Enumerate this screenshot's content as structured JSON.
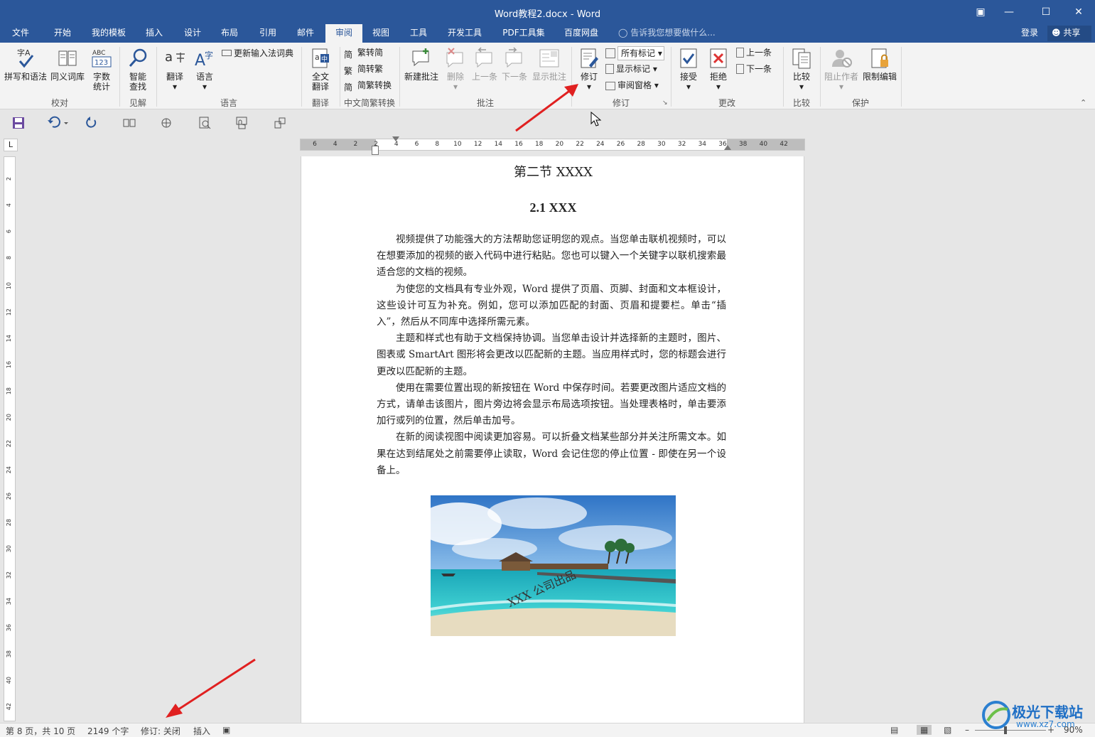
{
  "window": {
    "title": "Word教程2.docx - Word"
  },
  "menu": {
    "tabs": [
      "文件",
      "开始",
      "我的模板",
      "插入",
      "设计",
      "布局",
      "引用",
      "邮件",
      "审阅",
      "视图",
      "工具",
      "开发工具",
      "PDF工具集",
      "百度网盘"
    ],
    "active_tab": "审阅",
    "tell_me": "告诉我您想要做什么...",
    "login": "登录",
    "share": "共享"
  },
  "ribbon": {
    "groups": {
      "proofing": "校对",
      "insights": "见解",
      "language": "语言",
      "translate": "翻译",
      "chinese_conv": "中文简繁转换",
      "comments": "批注",
      "tracking": "修订",
      "changes": "更改",
      "compare": "比较",
      "protect": "保护"
    },
    "buttons": {
      "spelling": "拼写和语法",
      "thesaurus": "同义词库",
      "word_count_1": "字数",
      "word_count_2": "统计",
      "smart_lookup_1": "智能",
      "smart_lookup_2": "查找",
      "translate": "翻译",
      "language": "语言",
      "update_ime": "更新输入法词典",
      "full_translate_1": "全文",
      "full_translate_2": "翻译",
      "to_simplified": "繁转简",
      "to_traditional": "简转繁",
      "conversion": "简繁转换",
      "new_comment": "新建批注",
      "delete": "删除",
      "prev": "上一条",
      "next": "下一条",
      "show_comments": "显示批注",
      "track_changes": "修订",
      "all_markup": "所有标记",
      "show_markup": "显示标记",
      "review_pane": "审阅窗格",
      "accept": "接受",
      "reject": "拒绝",
      "prev_change": "上一条",
      "next_change": "下一条",
      "compare": "比较",
      "block_authors": "阻止作者",
      "restrict_editing": "限制编辑"
    }
  },
  "ruler": {
    "numbers": [
      "6",
      "4",
      "2",
      "2",
      "4",
      "6",
      "8",
      "10",
      "12",
      "14",
      "16",
      "18",
      "20",
      "22",
      "24",
      "26",
      "28",
      "30",
      "32",
      "34",
      "36",
      "38",
      "40",
      "42"
    ],
    "vertical": [
      "2",
      "4",
      "6",
      "8",
      "10",
      "12",
      "14",
      "16",
      "18",
      "20",
      "22",
      "24",
      "26",
      "28",
      "30",
      "32",
      "34",
      "36",
      "38",
      "40",
      "42"
    ]
  },
  "document": {
    "section_title": "第二节  XXXX",
    "heading": "2.1 XXX",
    "paragraphs": [
      "视频提供了功能强大的方法帮助您证明您的观点。当您单击联机视频时，可以在想要添加的视频的嵌入代码中进行粘贴。您也可以键入一个关键字以联机搜索最适合您的文档的视频。",
      "为使您的文档具有专业外观，Word 提供了页眉、页脚、封面和文本框设计，这些设计可互为补充。例如，您可以添加匹配的封面、页眉和提要栏。单击“插入”，然后从不同库中选择所需元素。",
      "主题和样式也有助于文档保持协调。当您单击设计并选择新的主题时，图片、图表或 SmartArt 图形将会更改以匹配新的主题。当应用样式时，您的标题会进行更改以匹配新的主题。",
      "使用在需要位置出现的新按钮在 Word 中保存时间。若要更改图片适应文档的方式，请单击该图片，图片旁边将会显示布局选项按钮。当处理表格时，单击要添加行或列的位置，然后单击加号。",
      "在新的阅读视图中阅读更加容易。可以折叠文档某些部分并关注所需文本。如果在达到结尾处之前需要停止读取，Word 会记住您的停止位置 - 即使在另一个设备上。"
    ],
    "image_watermark": "XXX 公司出品"
  },
  "status": {
    "page": "第 8 页，共 10 页",
    "words": "2149 个字",
    "track": "修订: 关闭",
    "mode": "插入",
    "zoom": "90%"
  },
  "watermark_site": {
    "name": "极光下载站",
    "url": "www.xz7.com"
  }
}
